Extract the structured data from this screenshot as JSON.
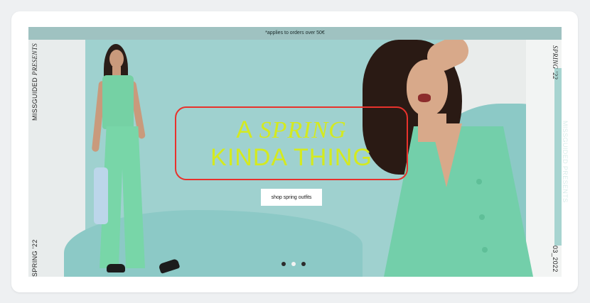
{
  "promo": {
    "text": "*applies to orders over 50€"
  },
  "side": {
    "top_left_brand": "MISSGUIDED",
    "top_left_italic": "PRESENTS",
    "bottom_left": "SPRING '22",
    "top_right": "SPRING '22",
    "middle_right": "MISSGUIDED PRESENTS",
    "bottom_right": "03_2022"
  },
  "headline": {
    "line1_prefix": "A",
    "line1_italic": "SPRING",
    "line2": "KINDA THING"
  },
  "cta": {
    "label": "shop spring outfits"
  },
  "carousel": {
    "slides": 3,
    "active": 2
  },
  "colors": {
    "accent_text": "#d4ea1f",
    "highlight": "#e8322c",
    "teal": "#9fd1cf",
    "mint_outfit": "#75d1a4"
  }
}
